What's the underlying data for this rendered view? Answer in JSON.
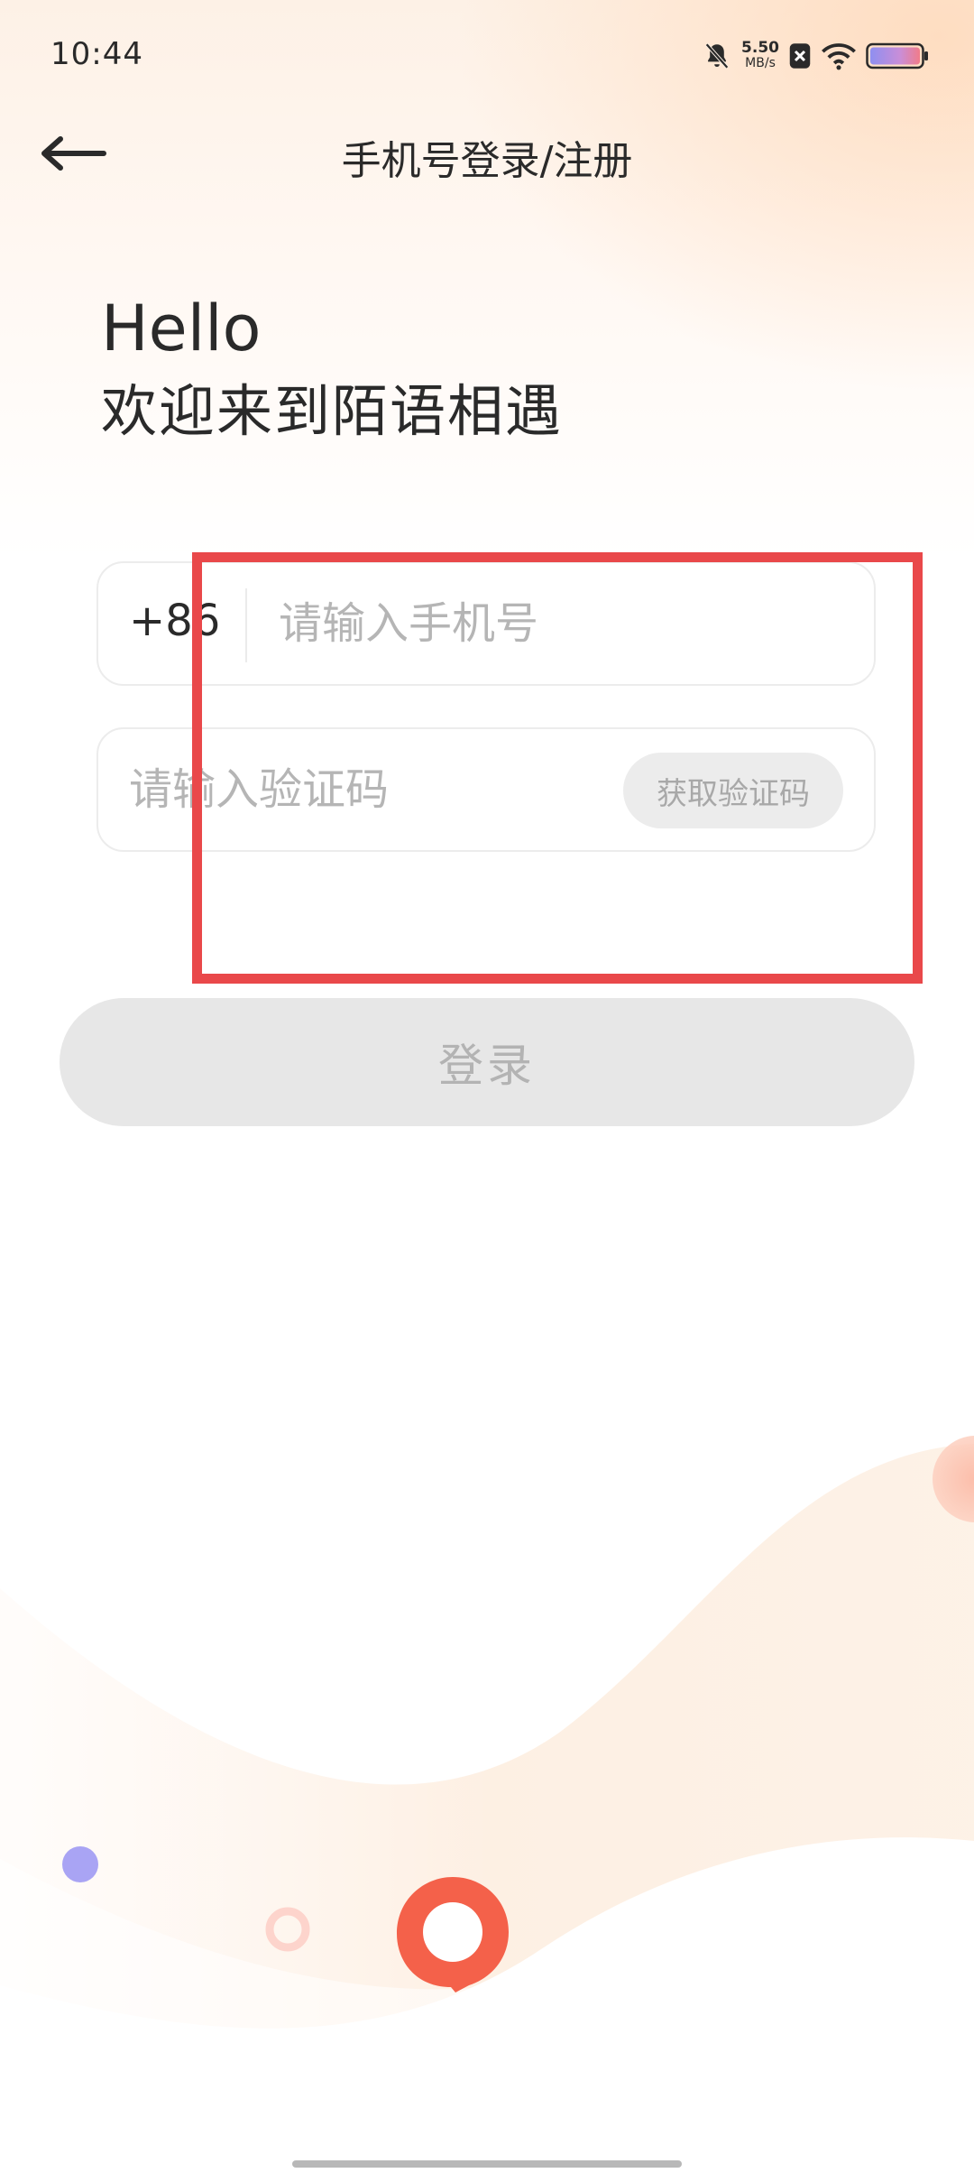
{
  "status_bar": {
    "time": "10:44",
    "network_speed_value": "5.50",
    "network_speed_unit": "MB/s",
    "icons": [
      "bell-muted-icon",
      "sim-blocked-icon",
      "wifi-icon",
      "battery-icon"
    ]
  },
  "nav": {
    "back_icon": "arrow-left-icon",
    "title": "手机号登录/注册"
  },
  "greeting": {
    "hello": "Hello",
    "welcome": "欢迎来到陌语相遇"
  },
  "phone_field": {
    "country_code": "+86",
    "value": "",
    "placeholder": "请输入手机号"
  },
  "code_field": {
    "value": "",
    "placeholder": "请输入验证码",
    "get_code_label": "获取验证码"
  },
  "login_button": {
    "label": "登录"
  },
  "colors": {
    "highlight_box": "#e9484a",
    "logo_orange": "#f4614a",
    "dot_purple": "#a9a4f4",
    "button_disabled_bg": "#e7e7e7",
    "placeholder_text": "#b5b5b5"
  }
}
